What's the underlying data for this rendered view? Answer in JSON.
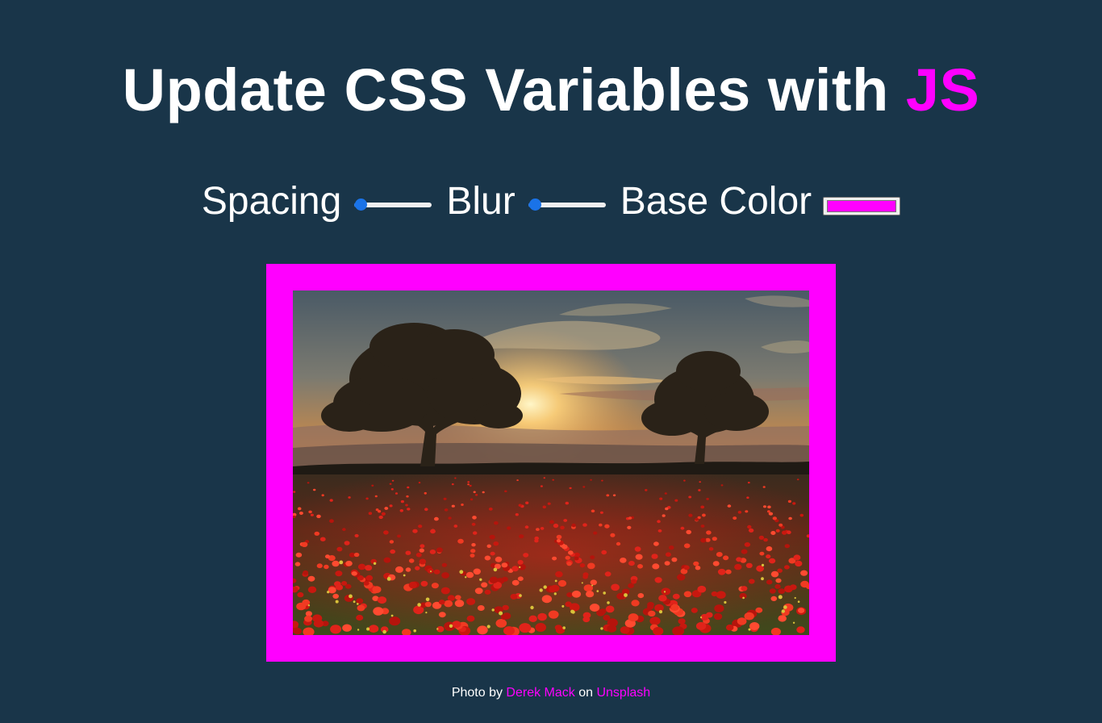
{
  "heading": {
    "text": "Update CSS Variables with ",
    "highlight": "JS"
  },
  "controls": {
    "spacing": {
      "label": "Spacing",
      "value": 10,
      "min": 10,
      "max": 200
    },
    "blur": {
      "label": "Blur",
      "value": 0,
      "min": 0,
      "max": 25
    },
    "base_color": {
      "label": "Base Color",
      "value": "#ff00ff"
    }
  },
  "colors": {
    "background": "#193549",
    "accent": "#ff00ff",
    "slider": "#1a73e8"
  },
  "image": {
    "subject": "sunset over a red poppy field with two trees"
  },
  "credit": {
    "prefix": "Photo by ",
    "author": "Derek Mack",
    "middle": " on ",
    "site": "Unsplash"
  }
}
